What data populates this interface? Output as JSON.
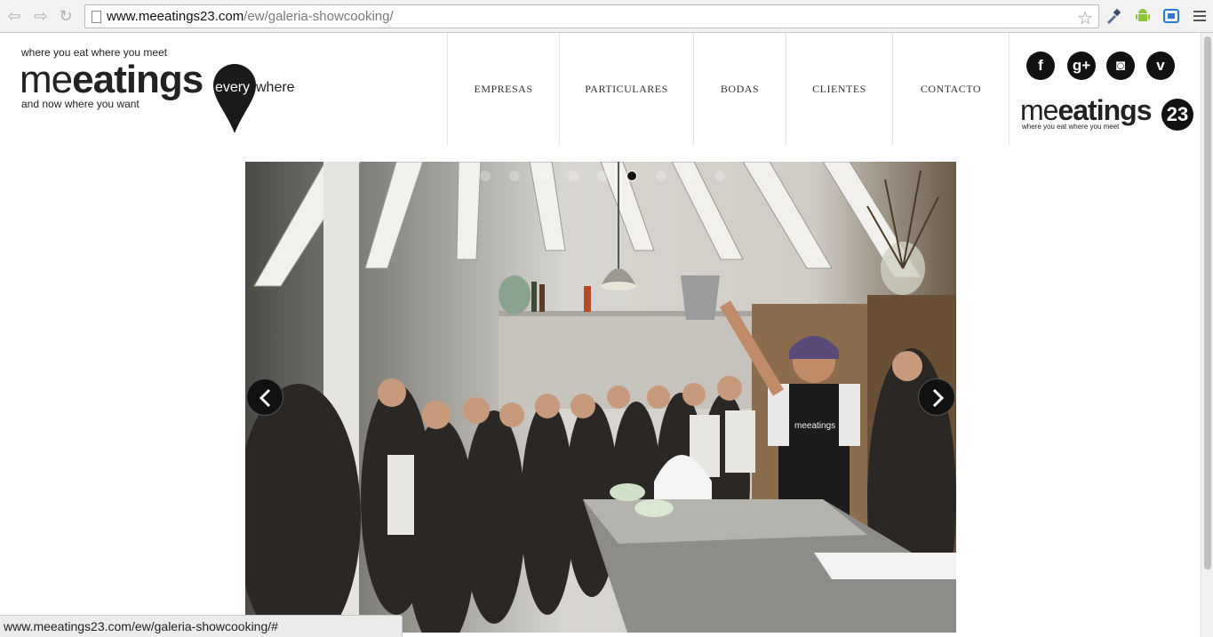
{
  "browser": {
    "url_domain": "www.meeatings23.com",
    "url_path": "/ew/galeria-showcooking/",
    "back_icon": "back-arrow-icon",
    "forward_icon": "forward-arrow-icon",
    "reload_icon": "reload-icon",
    "bookmark_icon": "star-icon"
  },
  "site": {
    "tagline_top": "where you eat where you meet",
    "brand_thin": "me",
    "brand_bold": "eatings",
    "tagline_bottom": "and now where you want",
    "pin_text": "every",
    "where_text": "where",
    "menu": [
      {
        "label": "EMPRESAS"
      },
      {
        "label": "PARTICULARES"
      },
      {
        "label": "BODAS"
      },
      {
        "label": "CLIENTES"
      },
      {
        "label": "CONTACTO"
      }
    ],
    "social": [
      {
        "icon": "facebook-icon",
        "glyph": "f"
      },
      {
        "icon": "google-plus-icon",
        "glyph": "g+"
      },
      {
        "icon": "instagram-icon",
        "glyph": "◙"
      },
      {
        "icon": "vimeo-icon",
        "glyph": "v"
      }
    ],
    "logo23": {
      "thin": "me",
      "bold": "eatings",
      "number": "23",
      "tagline": "where you eat where you meet"
    }
  },
  "slider": {
    "dot_count": 9,
    "active_index": 5,
    "prev_icon": "chevron-left-icon",
    "next_icon": "chevron-right-icon",
    "apron_text": "meeatings"
  },
  "status_bar": {
    "url": "www.meeatings23.com/ew/galeria-showcooking/#"
  }
}
